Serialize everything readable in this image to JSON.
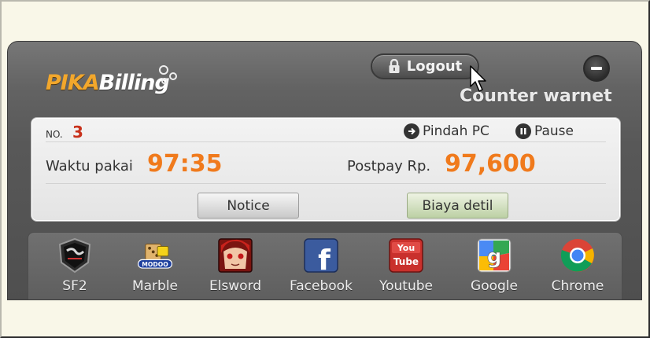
{
  "header": {
    "logo_primary": "PIKA",
    "logo_secondary": "Billing",
    "logout_label": "Logout",
    "subtitle": "Counter warnet"
  },
  "session": {
    "no_label": "NO.",
    "no_value": "3",
    "pindah_label": "Pindah PC",
    "pause_label": "Pause",
    "waktu_label": "Waktu pakai",
    "waktu_value": "97:35",
    "postpay_label": "Postpay Rp.",
    "postpay_value": "97,600"
  },
  "buttons": {
    "notice_label": "Notice",
    "biaya_label": "Biaya detil"
  },
  "apps": [
    {
      "label": "SF2",
      "icon": "sf2-icon"
    },
    {
      "label": "Marble",
      "icon": "modoo-marble-icon",
      "icon_text": "MODOO"
    },
    {
      "label": "Elsword",
      "icon": "elsword-icon"
    },
    {
      "label": "Facebook",
      "icon": "facebook-icon",
      "icon_text": "f"
    },
    {
      "label": "Youtube",
      "icon": "youtube-icon",
      "icon_text_top": "You",
      "icon_text_bottom": "Tube"
    },
    {
      "label": "Google",
      "icon": "google-icon"
    },
    {
      "label": "Chrome",
      "icon": "chrome-icon"
    }
  ],
  "colors": {
    "accent_orange": "#f07a1c",
    "number_red": "#c8311b",
    "logo_orange": "#f2a72c"
  }
}
